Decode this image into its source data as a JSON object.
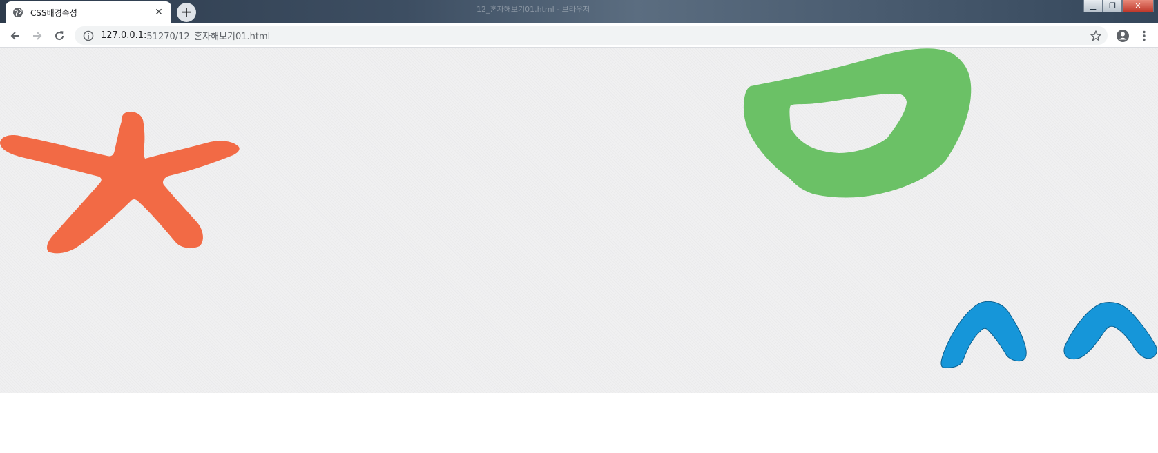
{
  "browser": {
    "tab": {
      "title": "CSS배경속성",
      "close_glyph": "✕",
      "icon": "globe-icon"
    },
    "new_tab_glyph": "+",
    "window_title": "12_혼자해보기01.html - 브라우저",
    "window_controls": {
      "minimize": "▁",
      "maximize": "❐",
      "close": "✕"
    },
    "nav": {
      "back_icon": "arrow-left-icon",
      "forward_icon": "arrow-right-icon",
      "reload_icon": "reload-icon"
    },
    "address": {
      "host": "127.0.0.1:",
      "path": "51270/12_혼자해보기01.html",
      "info_icon": "info-icon",
      "bookmark_icon": "star-icon"
    },
    "profile_icon": "account-icon",
    "menu_icon": "kebab-menu-icon"
  },
  "page": {
    "background": "#f0f0f1",
    "doodles": [
      {
        "name": "orange-star",
        "color": "#f26a45"
      },
      {
        "name": "green-bowl",
        "color": "#6bc166"
      },
      {
        "name": "blue-caret-left",
        "color": "#1696d9"
      },
      {
        "name": "blue-caret-right",
        "color": "#1696d9"
      }
    ]
  }
}
